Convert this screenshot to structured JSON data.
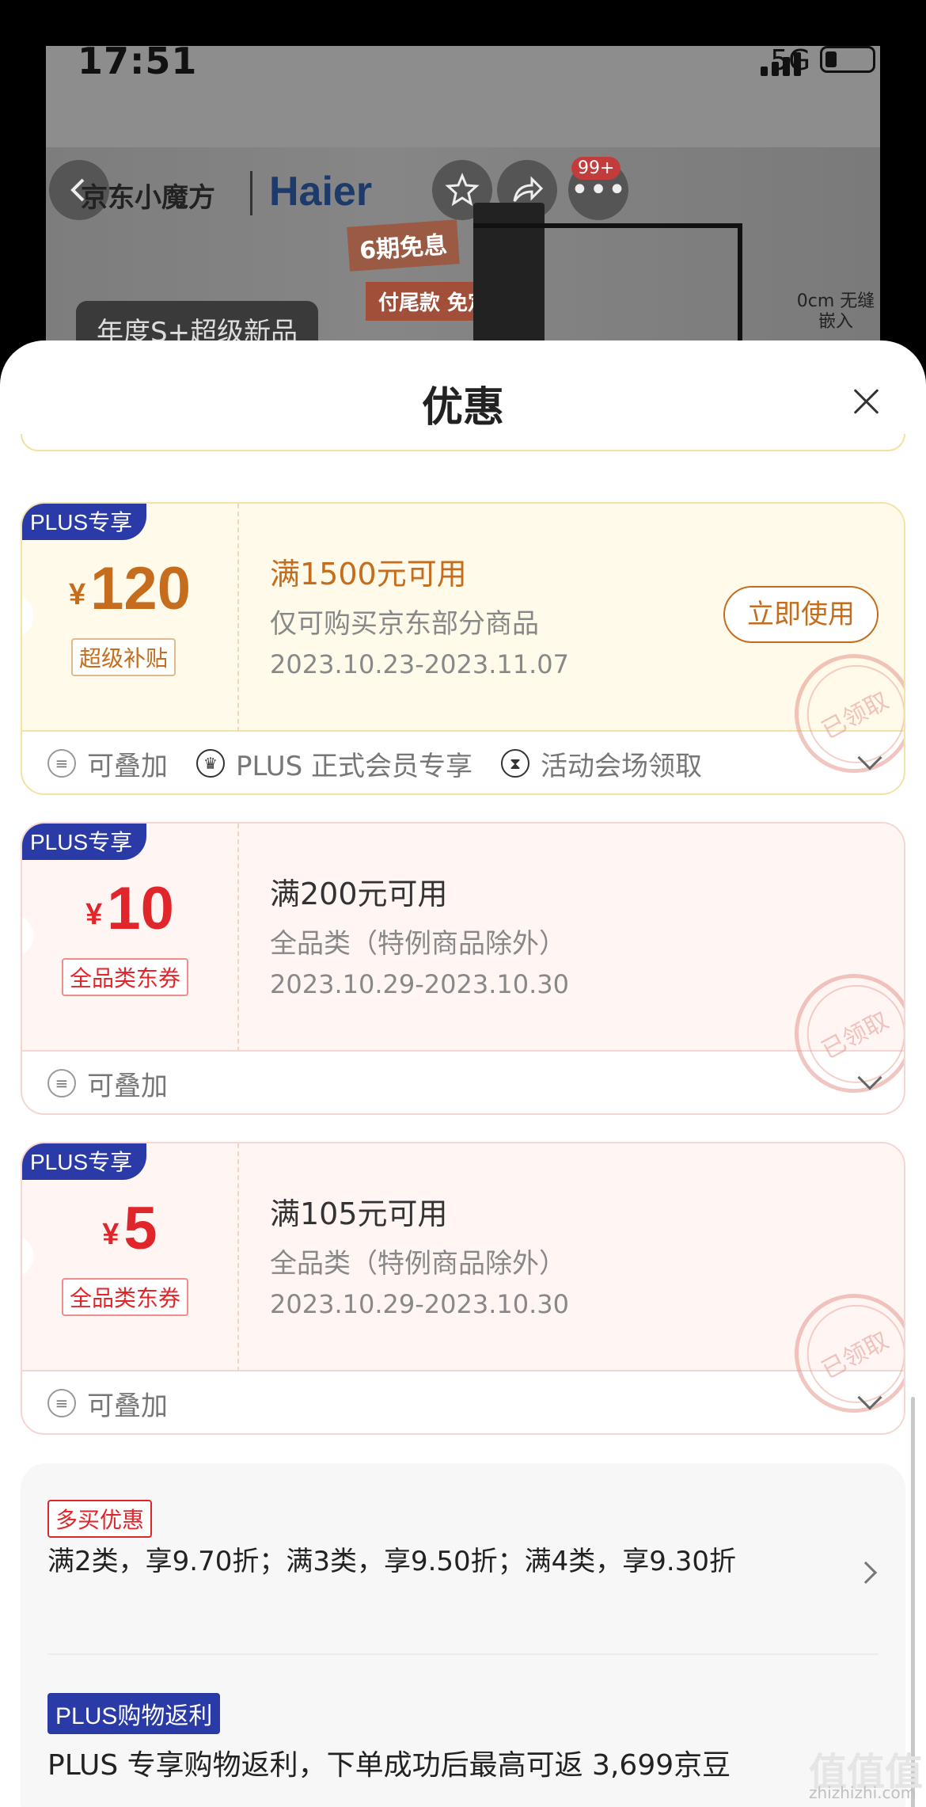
{
  "status_bar": {
    "time": "17:51",
    "network": "5G"
  },
  "background": {
    "brand": "京东小魔方",
    "brand2": "Haier",
    "promo1": "6期免息",
    "promo2": "付尾款 免定金",
    "year_tag": "年度S+超级新品",
    "embed_text": "0cm 无缝嵌入",
    "cart_count": "99+"
  },
  "sheet": {
    "title": "优惠"
  },
  "coupons": [
    {
      "plus_label": "PLUS专享",
      "currency": "¥",
      "amount": "120",
      "type_tag": "超级补贴",
      "condition": "满1500元可用",
      "scope": "仅可购买京东部分商品",
      "dates": "2023.10.23-2023.11.07",
      "use_button": "立即使用",
      "stamp": "已领取",
      "footer": [
        "可叠加",
        "PLUS 正式会员专享",
        "活动会场领取"
      ]
    },
    {
      "plus_label": "PLUS专享",
      "currency": "¥",
      "amount": "10",
      "type_tag": "全品类东券",
      "condition": "满200元可用",
      "scope": "全品类（特例商品除外）",
      "dates": "2023.10.29-2023.10.30",
      "stamp": "已领取",
      "footer": [
        "可叠加"
      ]
    },
    {
      "plus_label": "PLUS专享",
      "currency": "¥",
      "amount": "5",
      "type_tag": "全品类东券",
      "condition": "满105元可用",
      "scope": "全品类（特例商品除外）",
      "dates": "2023.10.29-2023.10.30",
      "stamp": "已领取",
      "footer": [
        "可叠加"
      ]
    }
  ],
  "multi_buy": {
    "badge": "多买优惠",
    "text": "满2类，享9.70折；满3类，享9.50折；满4类，享9.30折"
  },
  "rebate": {
    "badge": "PLUS购物返利",
    "text": "PLUS 专享购物返利，下单成功后最高可返 3,699京豆"
  },
  "watermark": {
    "logo": "值值值",
    "site": "zhizhizhi.com"
  },
  "colors": {
    "plus_blue": "#2a3aa6",
    "gold": "#c56d1c",
    "red": "#e0262b"
  }
}
